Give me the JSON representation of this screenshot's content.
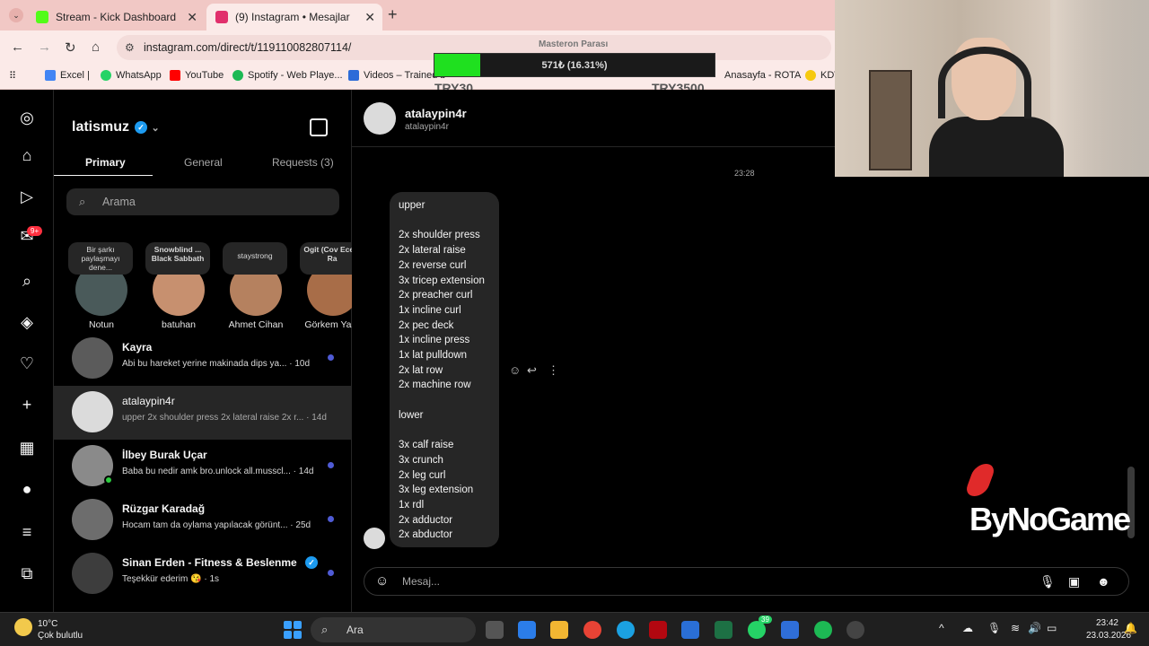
{
  "browser": {
    "tabs": [
      {
        "title": "Stream - Kick Dashboard",
        "color": "#53fc18"
      },
      {
        "title": "(9) Instagram • Mesajlar",
        "color": "#e1306c"
      }
    ],
    "url": "instagram.com/direct/t/119110082807114/",
    "bookmarks": [
      "Excel |",
      "WhatsApp",
      "YouTube",
      "Spotify - Web Playe...",
      "Videos – Trained b",
      "Anasayfa - ROTA",
      "KDV"
    ]
  },
  "goal": {
    "title": "Masteron Parası",
    "progress_text": "571₺ (16.31%)",
    "progress": 16.31,
    "left_label": "TRY30",
    "right_label": "TRY3500",
    "accent": "#1fe01f"
  },
  "inbox": {
    "username": "latismuz",
    "tabs": [
      "Primary",
      "General",
      "Requests (3)"
    ],
    "search_placeholder": "Arama",
    "notes": [
      {
        "bubble": "Bir şarkı paylaşmayı dene...",
        "name": "Notun"
      },
      {
        "bubble": "Snowblind ... Black Sabbath",
        "name": "batuhan"
      },
      {
        "bubble": "staystrong",
        "name": "Ahmet Cihan"
      },
      {
        "bubble": "Ogit (Cov Ecem Ra",
        "name": "Görkem Yaku"
      }
    ],
    "conversations": [
      {
        "name": "Kayra",
        "preview": "Abi bu hareket yerine makinada dips ya... · 10d",
        "unread": true
      },
      {
        "name": "atalaypin4r",
        "preview": "upper 2x shoulder press 2x lateral raise 2x r... · 14d",
        "unread": false,
        "selected": true
      },
      {
        "name": "İlbey Burak Uçar",
        "preview": "Baba bu nedir amk bro.unlock all.musscl... · 14d",
        "unread": true,
        "online": true
      },
      {
        "name": "Rüzgar Karadağ",
        "preview": "Hocam tam da oylama yapılacak görünt... · 25d",
        "unread": true
      },
      {
        "name": "Sinan Erden - Fitness & Beslenme",
        "preview": "Teşekkür ederim 😘 · 1s",
        "unread": true,
        "verified": true
      }
    ]
  },
  "chat": {
    "title": "atalaypin4r",
    "subtitle": "atalaypin4r",
    "timestamp": "23:28",
    "message_lines": [
      "upper",
      "",
      "2x shoulder press",
      "2x lateral raise",
      "2x reverse curl",
      "3x tricep extension",
      "2x preacher curl",
      "1x incline curl",
      "2x pec deck",
      "1x incline press",
      "1x lat pulldown",
      "2x lat row",
      "2x machine row",
      "",
      "lower",
      "",
      "3x calf raise",
      "3x crunch",
      "2x leg curl",
      "3x leg extension",
      "1x rdl",
      "2x adductor",
      "2x abductor"
    ],
    "compose_placeholder": "Mesaj..."
  },
  "overlay": {
    "logo": "ByNoGame"
  },
  "taskbar": {
    "weather_temp": "10°C",
    "weather_desc": "Çok bulutlu",
    "search": "Ara",
    "time": "23:42",
    "date": "23.03.2026",
    "whatsapp_badge": "39"
  },
  "icons": {
    "badge_count": "9+"
  }
}
